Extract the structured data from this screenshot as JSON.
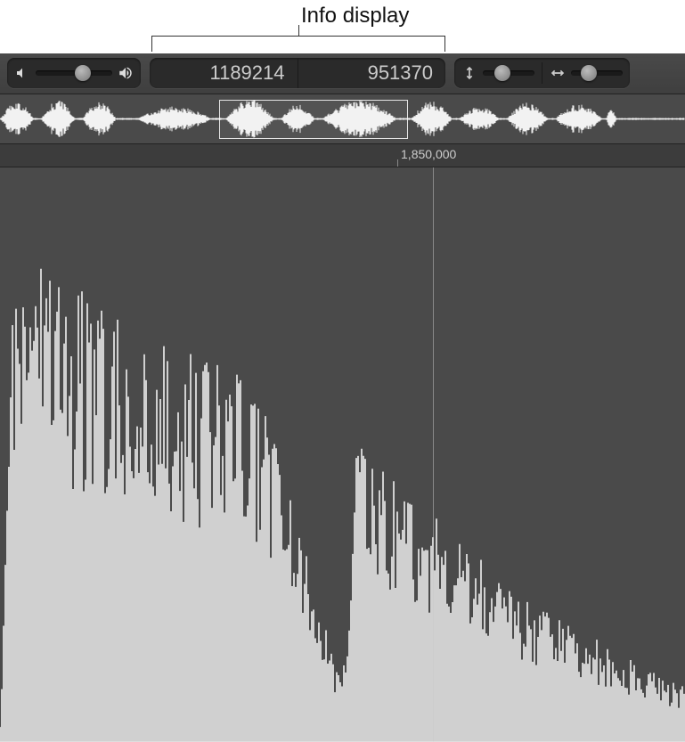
{
  "annotation": {
    "label": "Info display"
  },
  "toolbar": {
    "volume": {
      "value_pct": 62
    },
    "info": {
      "left_value": "1189214",
      "right_value": "951370"
    },
    "vertical_zoom": {
      "value_pct": 38
    },
    "horizontal_zoom": {
      "value_pct": 35
    }
  },
  "overview": {
    "selection_start_pct": 32.0,
    "selection_width_pct": 27.5
  },
  "ruler": {
    "ticks": [
      {
        "pos_pct": 58.0,
        "label": "1,850,000"
      }
    ]
  },
  "editor": {
    "playhead_pct": 63.2
  },
  "colors": {
    "waveform": "#f2f2f2",
    "bg": "#4a4a4a"
  }
}
